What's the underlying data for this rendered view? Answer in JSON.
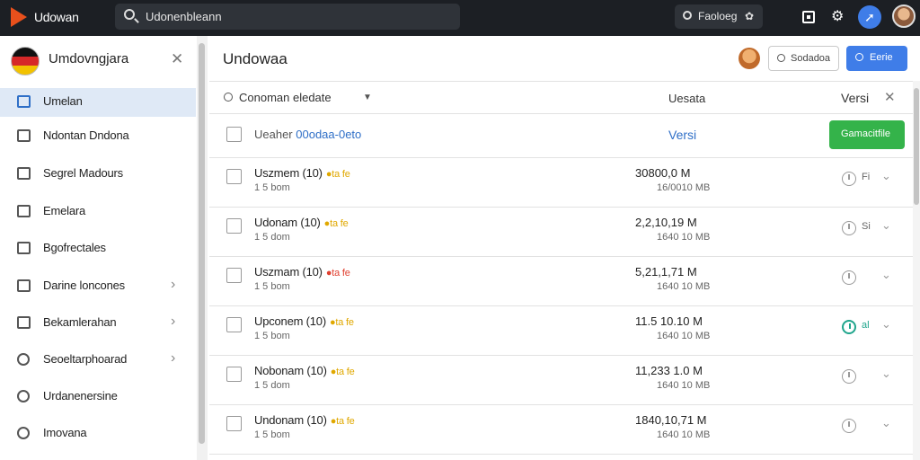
{
  "app": {
    "title": "Udowan",
    "search_text": "Udonenbleann",
    "feedback_label": "Faoloeg",
    "feedback_gear": "✿"
  },
  "sidebar": {
    "title": "Umdovngjara",
    "close_glyph": "✕",
    "items": [
      {
        "label": "Umelan",
        "active": true
      },
      {
        "label": "Ndontan Dndona"
      },
      {
        "label": "Segrel Madours"
      },
      {
        "label": "Emelara"
      },
      {
        "label": "Bgofrectales"
      },
      {
        "label": "Darine loncones",
        "chevron": "›"
      },
      {
        "label": "Bekamlerahan",
        "chevron": "›"
      },
      {
        "label": "Seoeltarphoarad",
        "chevron": "›"
      },
      {
        "label": "Urdanenersine"
      },
      {
        "label": "Imovana"
      }
    ]
  },
  "main": {
    "title": "Undowaa",
    "secondary_button": "Sodadoa",
    "primary_button": "Eerie",
    "filter_label": "Conoman eledate",
    "filter_caret": "▼",
    "col_status": "Uesata",
    "col_versi": "Versi",
    "col_close": "✕",
    "select_text": "Ueaher",
    "select_link": "00odaa-0eto",
    "versi_link": "Versi",
    "green_button": "Gamacitfile"
  },
  "rows": [
    {
      "name": "Uszmem (10)",
      "tag": "●ta fe",
      "tag_color": "#e0a800",
      "sub": "1 5 bom",
      "size": "30800,0 M",
      "date": "16/0010 MB",
      "ver": "Fi",
      "ok": false
    },
    {
      "name": "Udonam (10)",
      "tag": "●ta fe",
      "tag_color": "#e0a800",
      "sub": "1 5 dom",
      "size": "2,2,10,19 M",
      "date": "1640 10 MB",
      "ver": "Si",
      "ok": false
    },
    {
      "name": "Uszmam (10)",
      "tag": "●ta fe",
      "tag_color": "#e04030",
      "sub": "1 5 bom",
      "size": "5,21,1,71 M",
      "date": "1640 10 MB",
      "ver": "",
      "ok": false
    },
    {
      "name": "Upconem (10)",
      "tag": "●ta fe",
      "tag_color": "#e0a800",
      "sub": "1 5 bom",
      "size": "11.5 10.10 M",
      "date": "1640 10 MB",
      "ver": "al",
      "ok": true
    },
    {
      "name": "Nobonam (10)",
      "tag": "●ta fe",
      "tag_color": "#e0a800",
      "sub": "1 5 dom",
      "size": "11,233 1.0 M",
      "date": "1640 10 MB",
      "ver": "",
      "ok": false
    },
    {
      "name": "Undonam (10)",
      "tag": "●ta fe",
      "tag_color": "#e0a800",
      "sub": "1 5 bom",
      "size": "1840,10,71 M",
      "date": "1640 10 MB",
      "ver": "",
      "ok": false
    }
  ],
  "colors": {
    "topbar": "#1c1f24",
    "accent_blue": "#3f7de8",
    "link_blue": "#2f6fc7",
    "green": "#34b34a",
    "teal_ok": "#1fa58c",
    "sidebar_active": "#dfe9f6"
  }
}
